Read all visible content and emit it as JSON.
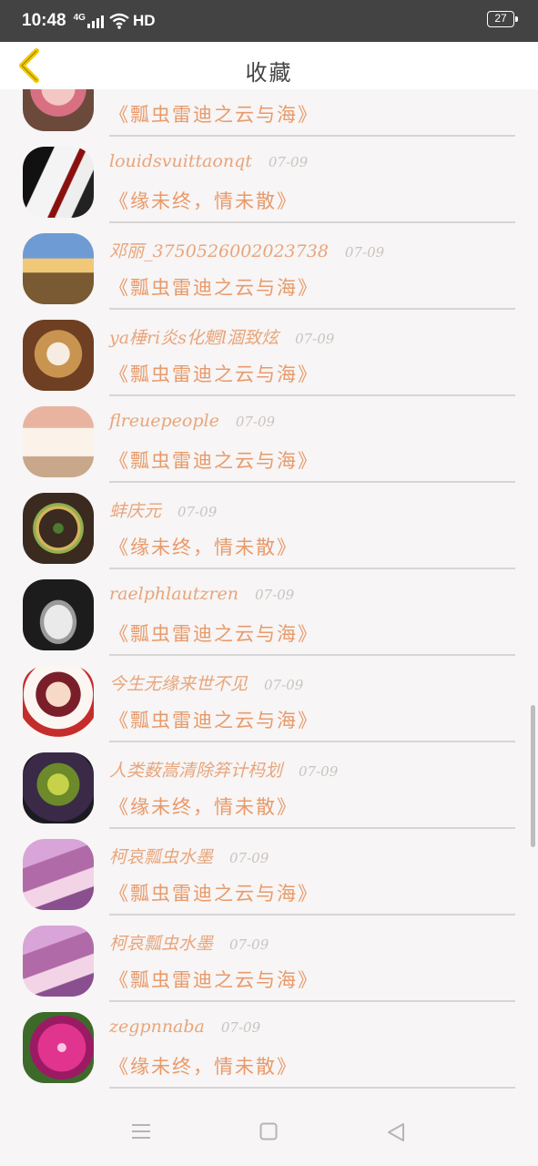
{
  "status_bar": {
    "time": "10:48",
    "network": "4G",
    "hd": "HD",
    "battery": "27"
  },
  "header": {
    "title": "收藏",
    "back_icon": "back-chevron-icon"
  },
  "colors": {
    "accent": "#e8a57c",
    "message": "#e89a6a",
    "date": "#c9c4c0",
    "back_icon": "#f0c800"
  },
  "favorites": [
    {
      "name": "",
      "date": "",
      "message": "《瓢虫雷迪之云与海》",
      "avatar": "pink-portrait"
    },
    {
      "name": "louidsvuittaonqt",
      "date": "07-09",
      "message": "《缘未终，情未散》",
      "avatar": "dark-hair-blood"
    },
    {
      "name": "邓丽_3750526002023738",
      "date": "07-09",
      "message": "《瓢虫雷迪之云与海》",
      "avatar": "lighthouse-sunset"
    },
    {
      "name": "ya棰ri炎s化魍l涸致炫",
      "date": "07-09",
      "message": "《瓢虫雷迪之云与海》",
      "avatar": "panda-latte"
    },
    {
      "name": "flreuepeople",
      "date": "07-09",
      "message": "《瓢虫雷迪之云与海》",
      "avatar": "coffee-mug"
    },
    {
      "name": "蚌庆元",
      "date": "07-09",
      "message": "《缘未终，情未散》",
      "avatar": "food-plate"
    },
    {
      "name": "raelphlautzren",
      "date": "07-09",
      "message": "《瓢虫雷迪之云与海》",
      "avatar": "hands-face-bw"
    },
    {
      "name": "今生无缘来世不见",
      "date": "07-09",
      "message": "《瓢虫雷迪之云与海》",
      "avatar": "ladybug-girl"
    },
    {
      "name": "人类薮嵩清除笲计杩划",
      "date": "07-09",
      "message": "《缘未终，情未散》",
      "avatar": "green-creature"
    },
    {
      "name": "柯哀瓢虫水墨",
      "date": "07-09",
      "message": "《瓢虫雷迪之云与海》",
      "avatar": "purple-room"
    },
    {
      "name": "柯哀瓢虫水墨",
      "date": "07-09",
      "message": "《瓢虫雷迪之云与海》",
      "avatar": "purple-room"
    },
    {
      "name": "zegpnnaba",
      "date": "07-09",
      "message": "《缘未终，情未散》",
      "avatar": "pink-flower"
    }
  ],
  "nav_bar": {
    "menu_icon": "menu-icon",
    "home_icon": "home-square-icon",
    "back_icon": "back-triangle-icon"
  }
}
